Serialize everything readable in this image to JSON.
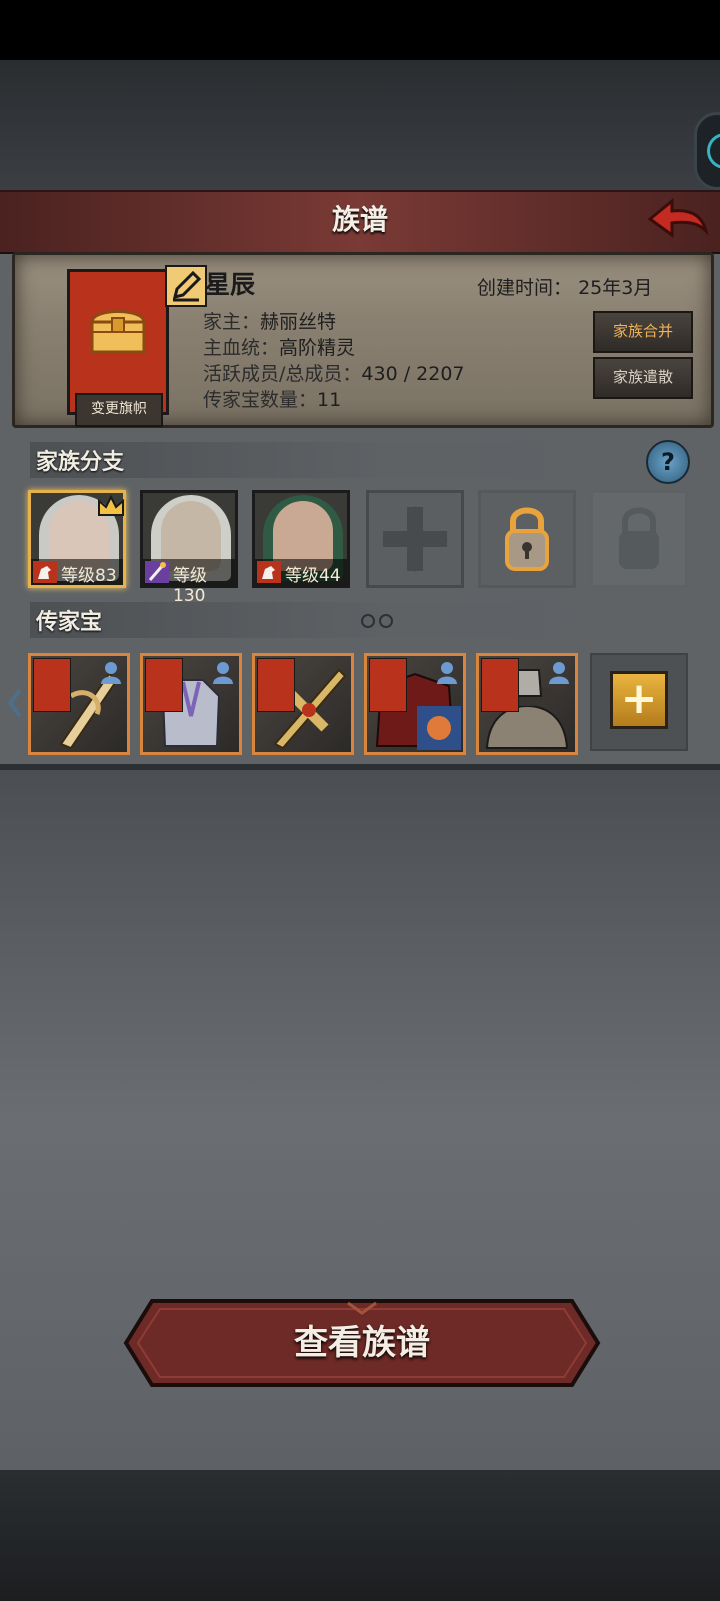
{
  "header": {
    "title": "族谱"
  },
  "clan": {
    "name": "星辰",
    "created_label": "创建时间：",
    "created_value": "25年3月",
    "leader_label": "家主：",
    "leader_value": "赫丽丝特",
    "bloodline_label": "主血统：",
    "bloodline_value": "高阶精灵",
    "members_label": "活跃成员/总成员：",
    "members_value": "430 / 2207",
    "heirloom_count_label": "传家宝数量：",
    "heirloom_count_value": "11",
    "change_banner_label": "变更旗帜",
    "merge_label": "家族合并",
    "disband_label": "家族遣散"
  },
  "branches": {
    "title": "家族分支",
    "members": [
      {
        "level_text": "等级83",
        "hair": "#c9c9c6",
        "selected": true,
        "crown": true
      },
      {
        "level_text": "等级130",
        "hair": "#cfcfca",
        "selected": false,
        "crown": false
      },
      {
        "level_text": "等级44",
        "hair": "#2f5a44",
        "selected": false,
        "crown": false
      }
    ]
  },
  "heirlooms": {
    "title": "传家宝",
    "items": [
      {
        "name": "golden-sword"
      },
      {
        "name": "silver-armor"
      },
      {
        "name": "golden-cross-blade"
      },
      {
        "name": "crimson-armor"
      },
      {
        "name": "fur-helm-armor"
      }
    ]
  },
  "footer": {
    "view_tree_label": "查看族谱"
  },
  "colors": {
    "accent_gold": "#e8b24a",
    "banner_red": "#b8321c",
    "title_bar": "#7a3a35"
  }
}
